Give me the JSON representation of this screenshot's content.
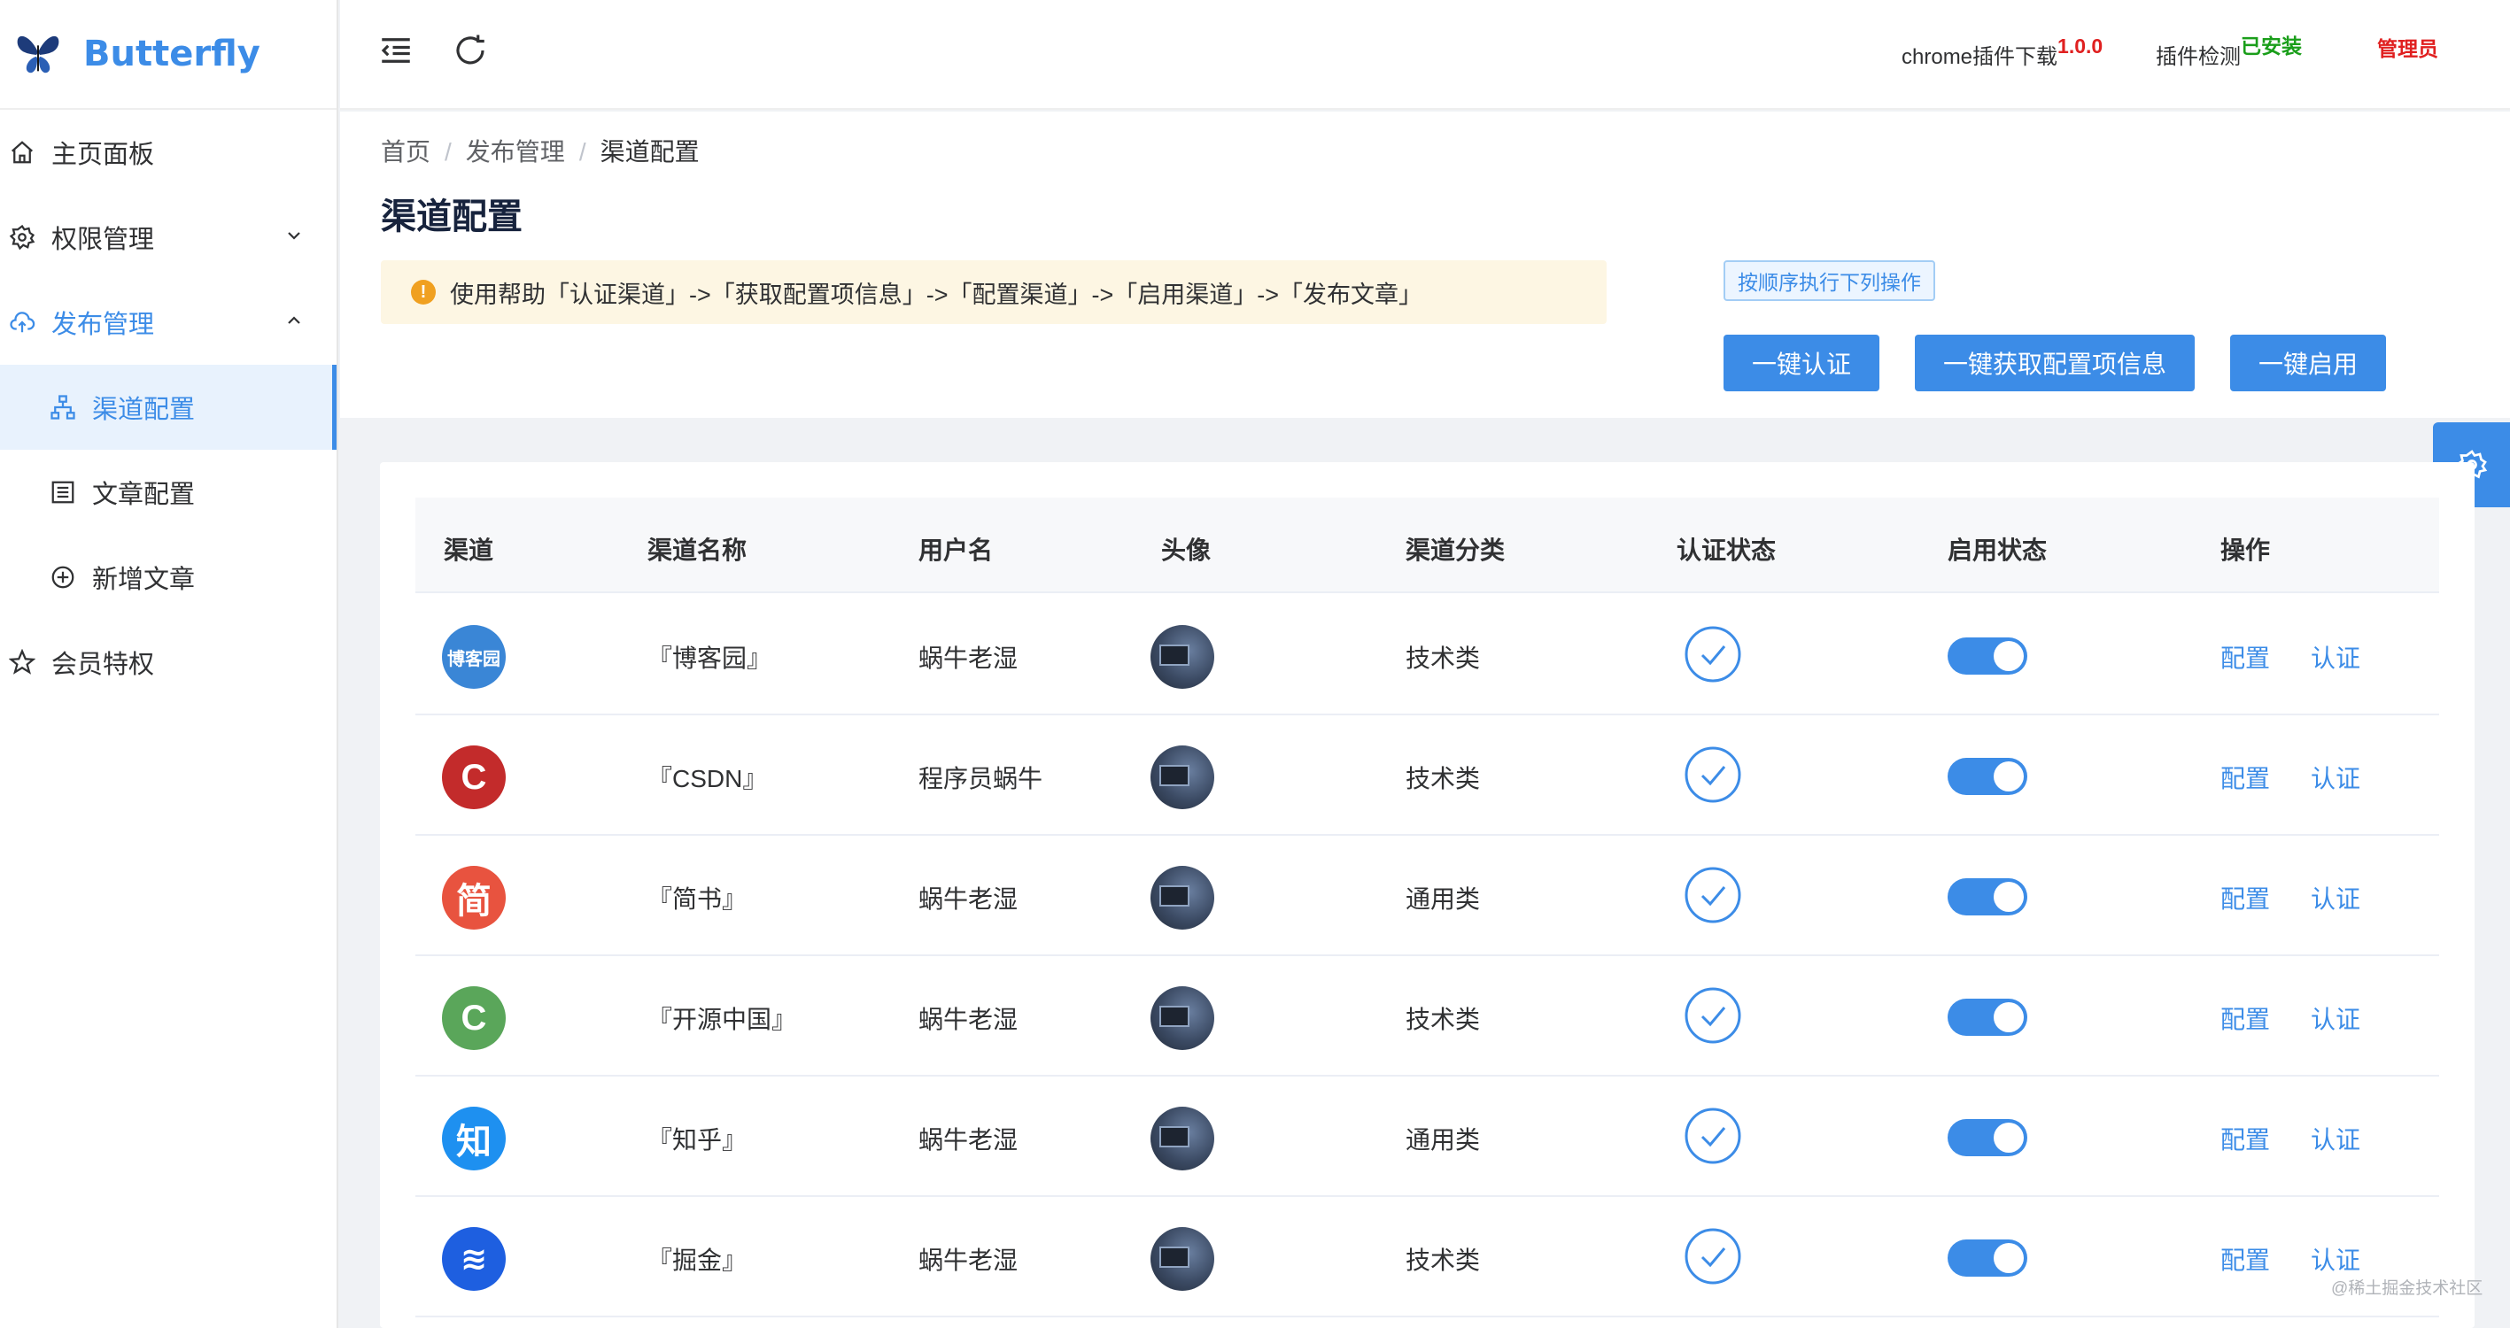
{
  "app": {
    "name": "Butterfly"
  },
  "sidebar": {
    "items": [
      {
        "label": "主页面板"
      },
      {
        "label": "权限管理"
      },
      {
        "label": "发布管理"
      },
      {
        "label": "会员特权"
      }
    ],
    "publish_submenu": [
      {
        "label": "渠道配置"
      },
      {
        "label": "文章配置"
      },
      {
        "label": "新增文章"
      }
    ]
  },
  "header": {
    "plugin_download": "chrome插件下载",
    "plugin_version": "1.0.0",
    "plugin_check": "插件检测",
    "plugin_status": "已安装",
    "user": "管理员"
  },
  "breadcrumb": [
    "首页",
    "发布管理",
    "渠道配置"
  ],
  "page": {
    "title": "渠道配置",
    "help_text": "使用帮助「认证渠道」->「获取配置项信息」->「配置渠道」->「启用渠道」->「发布文章」",
    "order_tag": "按顺序执行下列操作",
    "buttons": [
      "一键认证",
      "一键获取配置项信息",
      "一键启用"
    ]
  },
  "table": {
    "columns": [
      "渠道",
      "渠道名称",
      "用户名",
      "头像",
      "渠道分类",
      "认证状态",
      "启用状态",
      "操作"
    ],
    "rows": [
      {
        "logo": "博客园",
        "name": "『博客园』",
        "user": "蜗牛老湿",
        "category": "技术类",
        "configure": "配置",
        "auth": "认证"
      },
      {
        "logo": "C",
        "name": "『CSDN』",
        "user": "程序员蜗牛",
        "category": "技术类",
        "configure": "配置",
        "auth": "认证"
      },
      {
        "logo": "简",
        "name": "『简书』",
        "user": "蜗牛老湿",
        "category": "通用类",
        "configure": "配置",
        "auth": "认证"
      },
      {
        "logo": "C",
        "name": "『开源中国』",
        "user": "蜗牛老湿",
        "category": "技术类",
        "configure": "配置",
        "auth": "认证"
      },
      {
        "logo": "知",
        "name": "『知乎』",
        "user": "蜗牛老湿",
        "category": "通用类",
        "configure": "配置",
        "auth": "认证"
      },
      {
        "logo": "≋",
        "name": "『掘金』",
        "user": "蜗牛老湿",
        "category": "技术类",
        "configure": "配置",
        "auth": "认证"
      }
    ]
  },
  "watermark": "@稀土掘金技术社区",
  "colors": {
    "primary": "#3c8ce7",
    "version": "#e02020",
    "installed": "#1a9e1a"
  }
}
